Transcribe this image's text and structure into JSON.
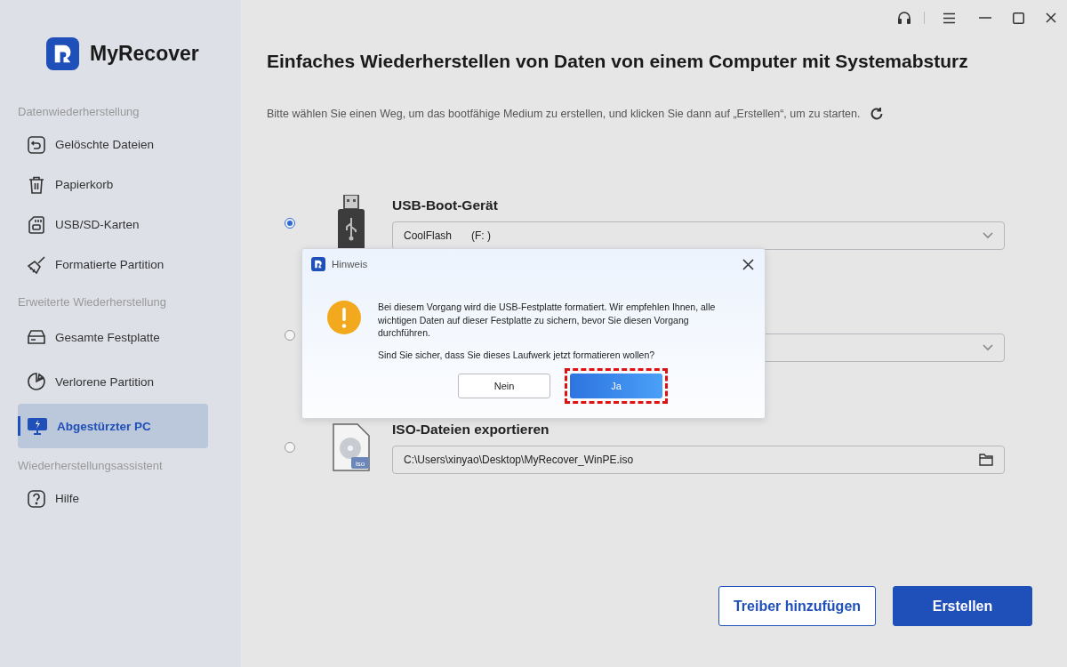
{
  "app": {
    "name": "MyRecover"
  },
  "sidebar": {
    "sections": [
      {
        "heading": "Datenwiederherstellung",
        "items": [
          {
            "label": "Gelöschte Dateien",
            "kind": "restore",
            "selected": false
          },
          {
            "label": "Papierkorb",
            "kind": "trash",
            "selected": false
          },
          {
            "label": "USB/SD-Karten",
            "kind": "sdcard",
            "selected": false
          },
          {
            "label": "Formatierte Partition",
            "kind": "broom",
            "selected": false
          }
        ]
      },
      {
        "heading": "Erweiterte Wiederherstellung",
        "items": [
          {
            "label": "Gesamte Festplatte",
            "kind": "drive",
            "selected": false
          },
          {
            "label": "Verlorene Partition",
            "kind": "pie",
            "selected": false
          },
          {
            "label": "Abgestürzter PC",
            "kind": "monitor",
            "selected": true
          }
        ]
      },
      {
        "heading": "Wiederherstellungsassistent",
        "items": [
          {
            "label": "Hilfe",
            "kind": "help",
            "selected": false
          }
        ]
      }
    ]
  },
  "page": {
    "title": "Einfaches Wiederherstellen von Daten von einem Computer mit Systemabsturz",
    "instruction": "Bitte wählen Sie einen Weg, um das bootfähige Medium zu erstellen, und klicken Sie dann auf „Erstellen“, um zu starten."
  },
  "options": [
    {
      "kind": "usb",
      "selected": true,
      "title": "USB-Boot-Gerät",
      "field": {
        "kind": "dropdown",
        "value": "CoolFlash",
        "drive": "(F: )"
      }
    },
    {
      "kind": "covered",
      "selected": false,
      "field": {
        "kind": "dropdown"
      }
    },
    {
      "kind": "iso",
      "selected": false,
      "title": "ISO-Dateien exportieren",
      "field": {
        "kind": "path",
        "value": "C:\\Users\\xinyao\\Desktop\\MyRecover_WinPE.iso"
      }
    }
  ],
  "footer_buttons": [
    {
      "label": "Treiber hinzufügen",
      "primary": false
    },
    {
      "label": "Erstellen",
      "primary": true
    }
  ],
  "dialog": {
    "title": "Hinweis",
    "message": "Bei diesem Vorgang wird die USB-Festplatte formatiert. Wir empfehlen Ihnen, alle wichtigen Daten auf dieser Festplatte zu sichern, bevor Sie diesen Vorgang durchführen.",
    "question": "Sind Sie sicher, dass Sie dieses Laufwerk jetzt formatieren wollen?",
    "buttons": [
      {
        "label": "Nein",
        "primary": false,
        "highlighted": false
      },
      {
        "label": "Ja",
        "primary": true,
        "highlighted": true
      }
    ]
  }
}
